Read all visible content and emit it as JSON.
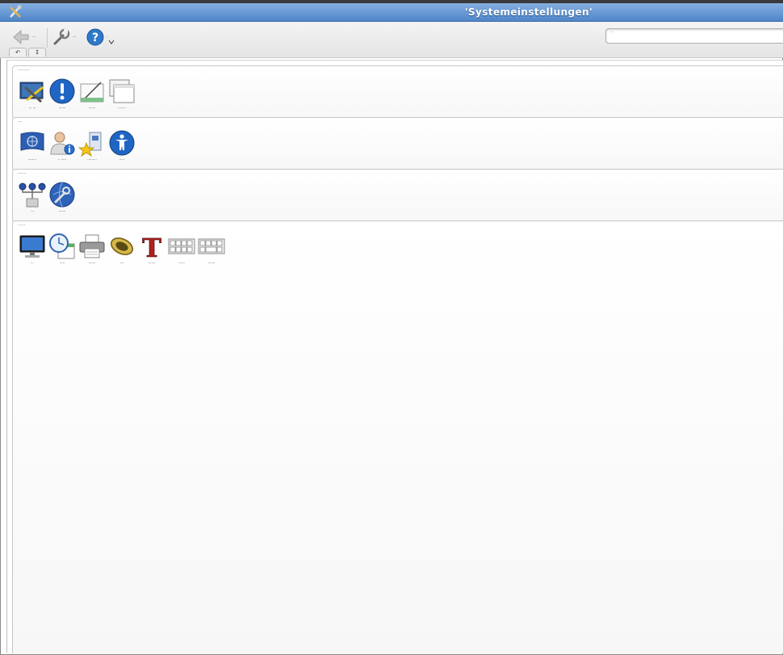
{
  "window": {
    "title": "'Systemeinstellungen'"
  },
  "toolbar": {
    "back_label": "···",
    "configure_label": "···",
    "help_label": "·",
    "search_placeholder": "···"
  },
  "mini_tabs": [
    "↶",
    "↧"
  ],
  "sections": [
    {
      "title": "·········",
      "items": [
        {
          "label": "··· ···",
          "icon": "desktop-tools-icon"
        },
        {
          "label": "·······",
          "icon": "notification-icon"
        },
        {
          "label": "·······",
          "icon": "appearance-icon"
        },
        {
          "label": "········",
          "icon": "window-behavior-icon"
        }
      ]
    },
    {
      "title": "····",
      "items": [
        {
          "label": "········",
          "icon": "locale-flag-icon"
        },
        {
          "label": "·· ·····",
          "icon": "user-account-icon"
        },
        {
          "label": "·········",
          "icon": "default-apps-icon"
        },
        {
          "label": "·····",
          "icon": "accessibility-icon"
        }
      ]
    },
    {
      "title": "·······",
      "items": [
        {
          "label": "···",
          "icon": "network-icon"
        },
        {
          "label": "·······",
          "icon": "network-settings-icon"
        }
      ]
    },
    {
      "title": "······",
      "items": [
        {
          "label": "···",
          "icon": "display-icon"
        },
        {
          "label": "·····",
          "icon": "date-time-icon"
        },
        {
          "label": "·······",
          "icon": "printer-icon"
        },
        {
          "label": "····",
          "icon": "sound-icon"
        },
        {
          "label": "·······",
          "icon": "fonts-icon"
        },
        {
          "label": "······",
          "icon": "keyboard-icon"
        },
        {
          "label": "·······",
          "icon": "keyboard-shortcuts-icon"
        }
      ]
    }
  ]
}
